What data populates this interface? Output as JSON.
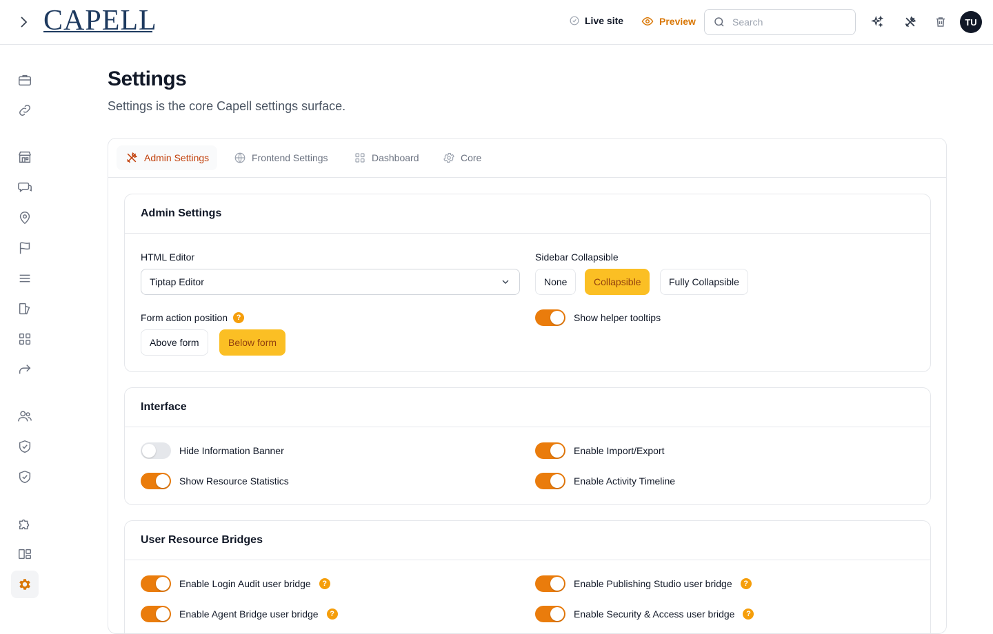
{
  "topbar": {
    "logo": "CAPELL",
    "live_site": "Live site",
    "preview": "Preview",
    "search_placeholder": "Search",
    "avatar_initials": "TU"
  },
  "page": {
    "title": "Settings",
    "subtitle": "Settings is the core Capell settings surface."
  },
  "tabs": [
    {
      "label": "Admin Settings",
      "active": true
    },
    {
      "label": "Frontend Settings",
      "active": false
    },
    {
      "label": "Dashboard",
      "active": false
    },
    {
      "label": "Core",
      "active": false
    }
  ],
  "admin_settings": {
    "title": "Admin Settings",
    "html_editor_label": "HTML Editor",
    "html_editor_value": "Tiptap Editor",
    "sidebar_label": "Sidebar Collapsible",
    "sidebar_options": [
      "None",
      "Collapsible",
      "Fully Collapsible"
    ],
    "sidebar_selected": "Collapsible",
    "form_action_label": "Form action position",
    "form_action_help": "?",
    "form_action_options": [
      "Above form",
      "Below form"
    ],
    "form_action_selected": "Below form",
    "helper_tooltips_label": "Show helper tooltips",
    "helper_tooltips_on": true
  },
  "interface": {
    "title": "Interface",
    "toggles": [
      {
        "label": "Hide Information Banner",
        "on": false
      },
      {
        "label": "Enable Import/Export",
        "on": true
      },
      {
        "label": "Show Resource Statistics",
        "on": true
      },
      {
        "label": "Enable Activity Timeline",
        "on": true
      }
    ]
  },
  "bridges": {
    "title": "User Resource Bridges",
    "toggles": [
      {
        "label": "Enable Login Audit user bridge",
        "on": true,
        "help": "?"
      },
      {
        "label": "Enable Publishing Studio user bridge",
        "on": true,
        "help": "?"
      },
      {
        "label": "Enable Agent Bridge user bridge",
        "on": true,
        "help": "?"
      },
      {
        "label": "Enable Security & Access user bridge",
        "on": true,
        "help": "?"
      }
    ]
  },
  "colors": {
    "accent": "#ea7c0c",
    "segment_selected": "#fbbf24",
    "help_badge": "#f59e0b"
  },
  "sidebar_icons": [
    "briefcase-icon",
    "link-icon",
    "store-icon",
    "chat-icon",
    "map-pin-icon",
    "flag-icon",
    "menu-icon",
    "layers-icon",
    "grid-icon",
    "redirect-icon",
    "users-icon",
    "shield-check-icon",
    "shield-check-icon",
    "puzzle-icon",
    "layout-icon",
    "settings-gear-icon"
  ]
}
